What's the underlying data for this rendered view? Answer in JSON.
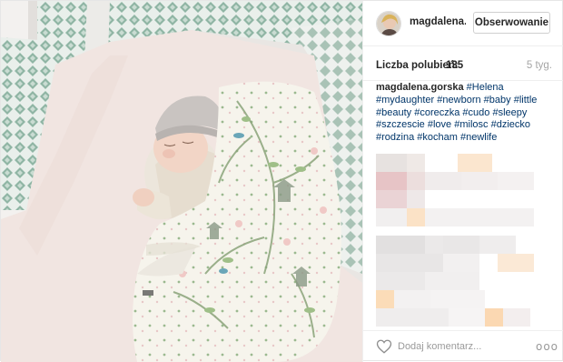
{
  "post": {
    "username": "magdalena....",
    "follow_label": "Obserwowanie",
    "likes_label": "Liczba polubień:",
    "likes_count": "135",
    "time_ago": "5 tyg.",
    "caption": {
      "author": "magdalena.gorska",
      "hashtags": [
        "#Helena",
        "#mydaughter",
        "#newborn",
        "#baby",
        "#little",
        "#beauty",
        "#coreczka",
        "#cudo",
        "#sleepy",
        "#szczescie",
        "#love",
        "#milosc",
        "#dziecko",
        "#rodzina",
        "#kocham",
        "#newlife"
      ]
    },
    "comment_placeholder": "Dodaj komentarz...",
    "more_label": "ooo"
  },
  "icons": {
    "like": "heart-outline-icon",
    "more": "more-options-icon"
  },
  "colors": {
    "hashtag": "#003569",
    "text": "#262626",
    "muted": "#a5a5a5",
    "border": "#efefef"
  }
}
